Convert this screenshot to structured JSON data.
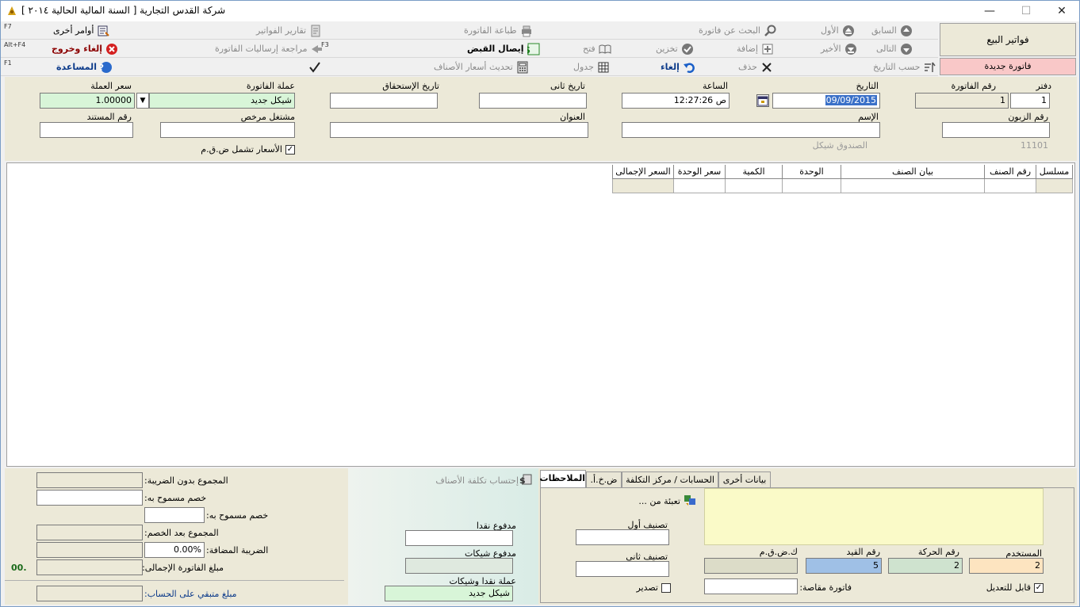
{
  "window": {
    "title": "شركة القدس التجارية [ السنة المالية الحالية ٢٠١٤ ]",
    "minimize": "—",
    "maximize": "☐",
    "close": "✕"
  },
  "toolbar": {
    "row1": {
      "previous": "السابق",
      "first": "الأول",
      "search_invoice": "البحث عن فاتورة",
      "print_invoice": "طباعة الفاتورة",
      "invoice_reports": "تقارير الفواتير",
      "other_commands": "أوامر أخرى",
      "other_commands_key": "F7"
    },
    "row2": {
      "next": "التالى",
      "last": "الأخير",
      "add": "إضافة",
      "store": "تخزين",
      "open": "فتح",
      "receipt": "إيصال القبض",
      "review_sent": "مراجعة إرساليات الفاتورة",
      "review_sent_key": "F3",
      "cancel_exit": "إلغاء وخروج",
      "cancel_exit_key": "Alt+F4"
    },
    "row3": {
      "by_date": "حسب التاريخ",
      "delete": "حذف",
      "cancel": "إلغاء",
      "table": "جدول",
      "update_prices": "تحديث أسعار الأصناف",
      "help": "المساعدة",
      "help_key": "F1"
    },
    "sales_invoices": "فواتير البيع",
    "new_invoice": "فاتورة جديدة"
  },
  "header": {
    "book_label": "دفتر",
    "book_value": "1",
    "invoice_no_label": "رقم الفاتورة",
    "invoice_no_value": "1",
    "date_label": "التاريخ",
    "date_value": "09/09/2015",
    "time_label": "الساعة",
    "time_value": "12:27:26 ص",
    "second_date_label": "تاريخ ثانى",
    "second_date_value": "",
    "due_date_label": "تاريخ الإستحقاق",
    "due_date_value": "",
    "currency_label": "عملة الفاتورة",
    "currency_value": "شيكل جديد",
    "rate_label": "سعر العملة",
    "rate_value": "1.00000",
    "customer_no_label": "رقم الزبون",
    "customer_no_value": "",
    "name_label": "الإسم",
    "name_value": "",
    "address_label": "العنوان",
    "address_value": "",
    "licensed_label": "مشتغل مرخص",
    "licensed_value": "",
    "doc_no_label": "رقم المستند",
    "doc_no_value": "",
    "account_code": "11101",
    "account_name": "الصندوق شيكل",
    "prices_include_vat_label": "الأسعار تشمل ض.ق.م",
    "prices_include_vat_checked": "✓"
  },
  "grid": {
    "columns": [
      "مسلسل",
      "رقم الصنف",
      "بيان الصنف",
      "الوحدة",
      "الكمية",
      "سعر الوحدة",
      "السعر الإجمالى"
    ]
  },
  "totals": {
    "subtotal_label": "المجموع بدون الضريبة:",
    "discount1_label": "خصم مسموح به:",
    "discount2_label": "خصم مسموح به:",
    "after_discount_label": "المجموع بعد الخصم:",
    "vat_label": "الضريبة المضافة:",
    "vat_value": "0.00%",
    "total_label": "مبلغ  الفاتورة الإجمالى:",
    "total_value": ".00",
    "remaining_label": "مبلغ متبقي على الحساب:"
  },
  "payment": {
    "cost_calc": "إحتساب تكلفة الأصناف",
    "cash_paid_label": "مدفوع  نقدا",
    "cash_paid_value": "",
    "cheques_paid_label": "مدفوع شيكات",
    "cheques_paid_value": "",
    "currency_label": "عملة نقدا وشيكات",
    "currency_value": "شيكل جديد"
  },
  "tabs": {
    "items": [
      "بيانات أخرى",
      "الحسابات / مركز التكلفة",
      "ض.خ.أ.",
      "الملاحظات"
    ],
    "active": "الملاحظات"
  },
  "notes": {
    "fill_from": "تعبئة من ...",
    "class1_label": "تصنيف أول",
    "class2_label": "تصنيف ثانى",
    "export_label": "تصدير",
    "user_label": "المستخدم",
    "user_value": "2",
    "movement_no_label": "رقم الحركة",
    "movement_no_value": "2",
    "entry_no_label": "رقم القيد",
    "entry_no_value": "5",
    "vat_no_label": "ك.ض.ق.م",
    "vat_no_value": "",
    "offset_invoice_label": "فاتورة مقاصة:",
    "editable_label": "قابل للتعديل",
    "editable_checked": "✓"
  },
  "colors": {
    "new_invoice_bg": "#f9c8c8",
    "green_field": "#d8f5d8",
    "user_field": "#fde4c0",
    "movement_field": "#cfe3cf",
    "entry_field": "#9fc0e6",
    "note_area": "#fafac8"
  }
}
